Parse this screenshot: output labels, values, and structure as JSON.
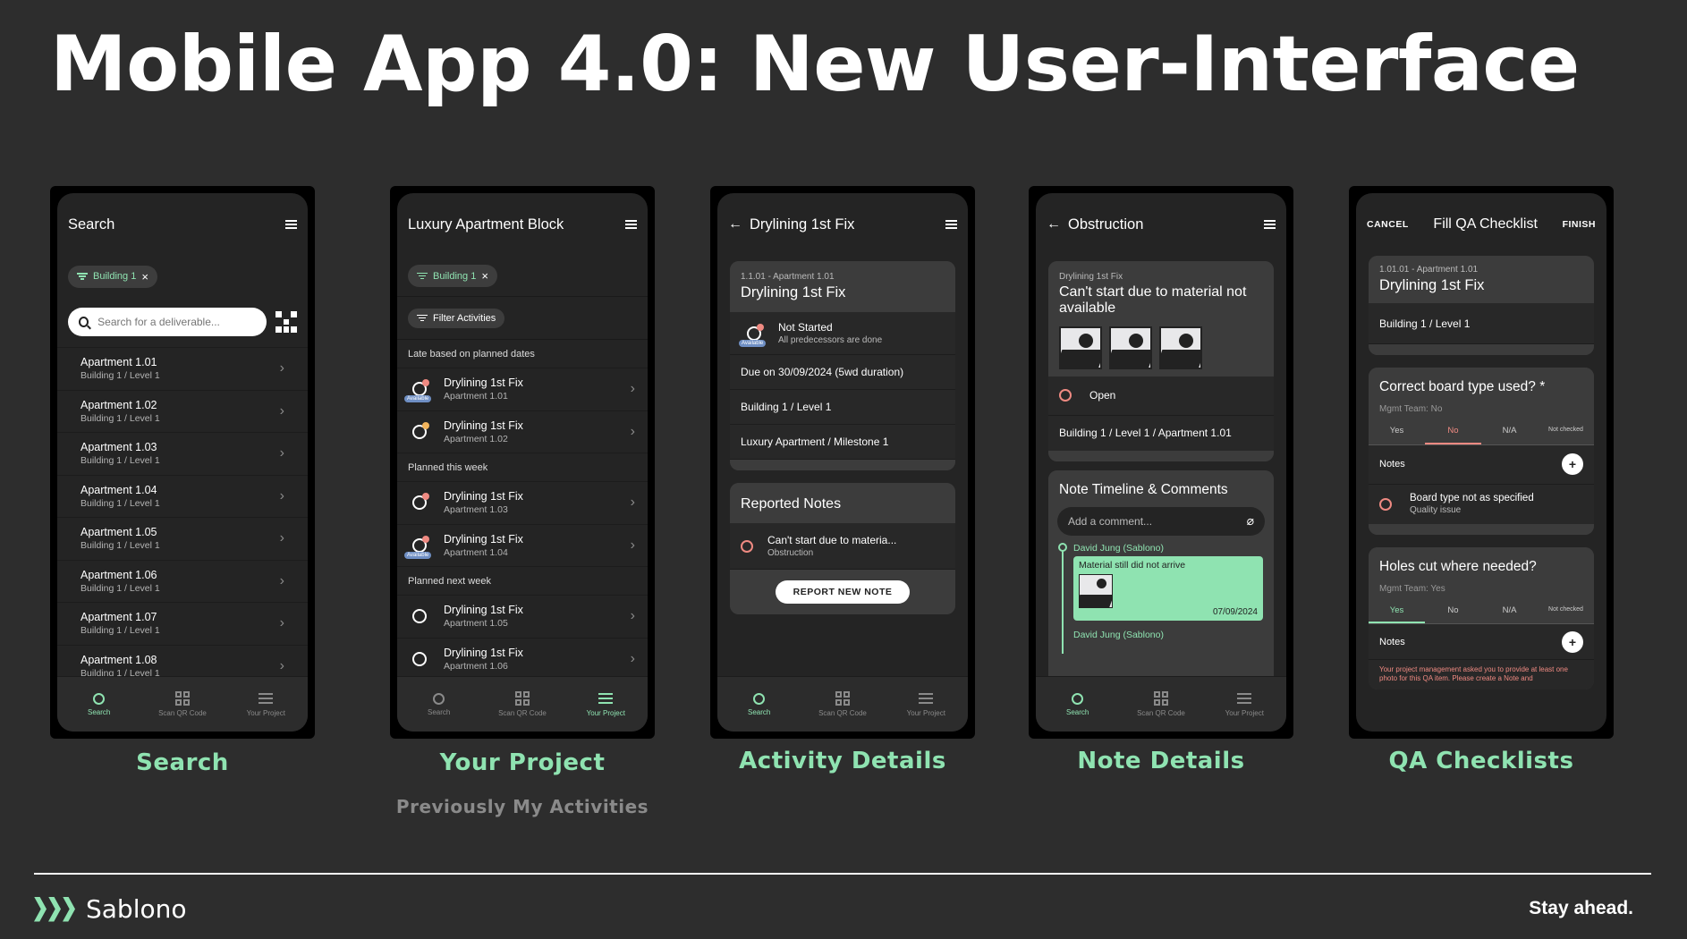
{
  "slide": {
    "title": "Mobile App 4.0: New User-Interface",
    "tagline": "Stay ahead.",
    "brand": "Sablono",
    "accent": "#8fe3b1"
  },
  "nav": {
    "search": "Search",
    "scan": "Scan QR Code",
    "project": "Your Project"
  },
  "screens": {
    "search": {
      "title": "Search",
      "chip": "Building 1",
      "placeholder": "Search for a deliverable...",
      "items": [
        {
          "name": "Apartment 1.01",
          "loc": "Building 1 / Level 1"
        },
        {
          "name": "Apartment 1.02",
          "loc": "Building 1 / Level 1"
        },
        {
          "name": "Apartment 1.03",
          "loc": "Building 1 / Level 1"
        },
        {
          "name": "Apartment 1.04",
          "loc": "Building 1 / Level 1"
        },
        {
          "name": "Apartment 1.05",
          "loc": "Building 1 / Level 1"
        },
        {
          "name": "Apartment 1.06",
          "loc": "Building 1 / Level 1"
        },
        {
          "name": "Apartment 1.07",
          "loc": "Building 1 / Level 1"
        },
        {
          "name": "Apartment 1.08",
          "loc": "Building 1 / Level 1"
        }
      ],
      "label": "Search"
    },
    "project": {
      "title": "Luxury Apartment Block",
      "chip": "Building 1",
      "filter": "Filter Activities",
      "available": "Available",
      "sections": [
        {
          "header": "Late based on planned dates",
          "items": [
            {
              "name": "Drylining 1st Fix",
              "loc": "Apartment 1.01",
              "icon": "available"
            },
            {
              "name": "Drylining 1st Fix",
              "loc": "Apartment 1.02",
              "icon": "progress"
            }
          ]
        },
        {
          "header": "Planned this week",
          "items": [
            {
              "name": "Drylining 1st Fix",
              "loc": "Apartment 1.03",
              "icon": "late"
            },
            {
              "name": "Drylining 1st Fix",
              "loc": "Apartment 1.04",
              "icon": "available"
            }
          ]
        },
        {
          "header": "Planned next week",
          "items": [
            {
              "name": "Drylining 1st Fix",
              "loc": "Apartment 1.05",
              "icon": "empty"
            },
            {
              "name": "Drylining 1st Fix",
              "loc": "Apartment 1.06",
              "icon": "empty"
            }
          ]
        }
      ],
      "label": "Your Project",
      "sublabel": "Previously My Activities"
    },
    "activity": {
      "title": "Drylining 1st Fix",
      "card_sub": "1.1.01 - Apartment 1.01",
      "card_title": "Drylining 1st Fix",
      "status": "Not Started",
      "status_sub": "All predecessors are done",
      "available": "Available",
      "due": "Due on 30/09/2024 (5wd duration)",
      "location": "Building 1 / Level 1",
      "milestone": "Luxury Apartment / Milestone 1",
      "notes_title": "Reported Notes",
      "note_text": "Can't start due to materia...",
      "note_type": "Obstruction",
      "report_btn": "REPORT NEW NOTE",
      "label": "Activity Details"
    },
    "note": {
      "title": "Obstruction",
      "card_sub": "Drylining 1st Fix",
      "card_title": "Can't start due to material not available",
      "status": "Open",
      "location": "Building 1 / Level 1 / Apartment 1.01",
      "timeline_title": "Note Timeline & Comments",
      "comment_placeholder": "Add a comment...",
      "author": "David Jung (Sablono)",
      "comment_text": "Material still did not arrive",
      "comment_date": "07/09/2024",
      "author2": "David Jung (Sablono)",
      "label": "Note Details"
    },
    "qa": {
      "cancel": "CANCEL",
      "title": "Fill QA Checklist",
      "finish": "FINISH",
      "card_sub": "1.01.01 - Apartment 1.01",
      "card_title": "Drylining 1st Fix",
      "location": "Building 1 / Level 1",
      "q1": "Correct board type used? *",
      "q1_team": "Mgmt Team: No",
      "tabs": [
        "Yes",
        "No",
        "N/A",
        "Not checked"
      ],
      "notes": "Notes",
      "issue_title": "Board type not as specified",
      "issue_type": "Quality issue",
      "q2": "Holes cut where needed?",
      "q2_team": "Mgmt Team: Yes",
      "warning": "Your project management asked you to provide at least one photo for this QA item. Please create a Note and",
      "label": "QA Checklists"
    }
  }
}
